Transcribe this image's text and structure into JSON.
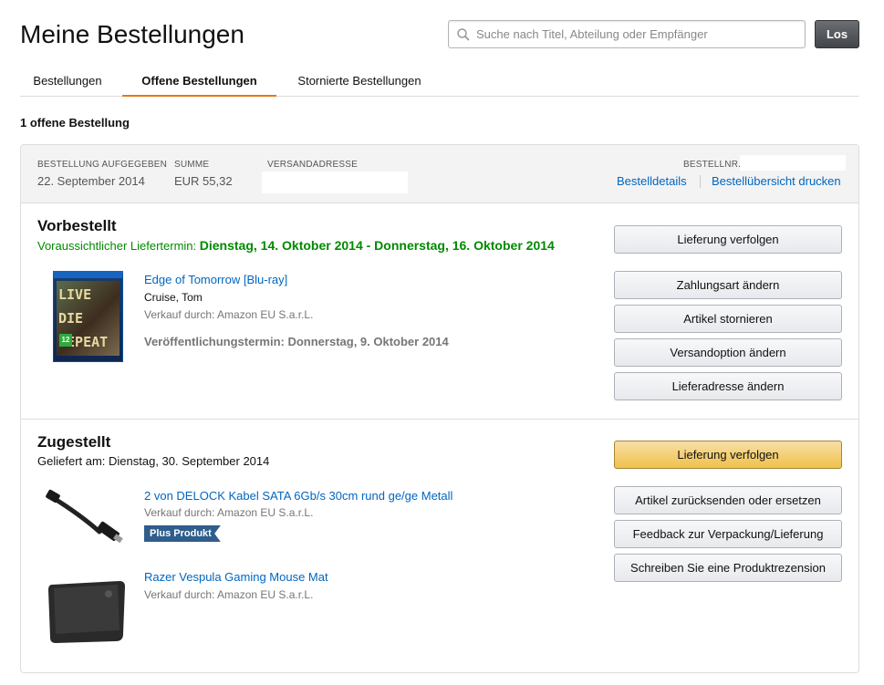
{
  "page": {
    "title": "Meine Bestellungen"
  },
  "search": {
    "placeholder": "Suche nach Titel, Abteilung oder Empfänger",
    "value": "",
    "button_label": "Los"
  },
  "tabs": [
    {
      "label": "Bestellungen",
      "active": false
    },
    {
      "label": "Offene Bestellungen",
      "active": true
    },
    {
      "label": "Stornierte Bestellungen",
      "active": false
    }
  ],
  "open_count": "1 offene Bestellung",
  "order": {
    "placed_label": "Bestellung aufgegeben",
    "placed_value": "22. September 2014",
    "total_label": "Summe",
    "total_value": "EUR 55,32",
    "address_label": "Versandadresse",
    "order_no_label": "Bestellnr.",
    "details_link": "Bestelldetails",
    "print_link": "Bestellübersicht drucken"
  },
  "shipments": [
    {
      "status": "Vorbestellt",
      "delivery_prefix": "Voraussichtlicher Liefertermin:",
      "delivery_range": "Dienstag, 14. Oktober 2014 - Donnerstag, 16. Oktober 2014",
      "items": [
        {
          "title": "Edge of Tomorrow [Blu-ray]",
          "author": "Cruise, Tom",
          "seller": "Verkauf durch: Amazon EU S.a.r.L.",
          "release": "Veröffentlichungstermin: Donnerstag, 9. Oktober 2014",
          "cover_text": [
            "LIVE",
            "DIE",
            "REPEAT"
          ],
          "cover_badge": "12"
        }
      ],
      "buttons": [
        "Lieferung verfolgen",
        "Zahlungsart ändern",
        "Artikel stornieren",
        "Versandoption ändern",
        "Lieferadresse ändern"
      ]
    },
    {
      "status": "Zugestellt",
      "delivery_text": "Geliefert am: Dienstag, 30. September 2014",
      "items": [
        {
          "title": "2 von DELOCK Kabel SATA 6Gb/s 30cm rund ge/ge Metall",
          "seller": "Verkauf durch: Amazon EU S.a.r.L.",
          "badge": "Plus Produkt"
        },
        {
          "title": "Razer Vespula Gaming Mouse Mat",
          "seller": "Verkauf durch: Amazon EU S.a.r.L."
        }
      ],
      "buttons": [
        "Lieferung verfolgen",
        "Artikel zurücksenden oder ersetzen",
        "Feedback zur Verpackung/Lieferung",
        "Schreiben Sie eine Produktrezension"
      ]
    }
  ],
  "colors": {
    "link": "#0066c0",
    "green": "#008a00",
    "primary_button": "#f0c14b",
    "tab_underline": "#e47911",
    "plus_badge": "#2f5d8c"
  }
}
